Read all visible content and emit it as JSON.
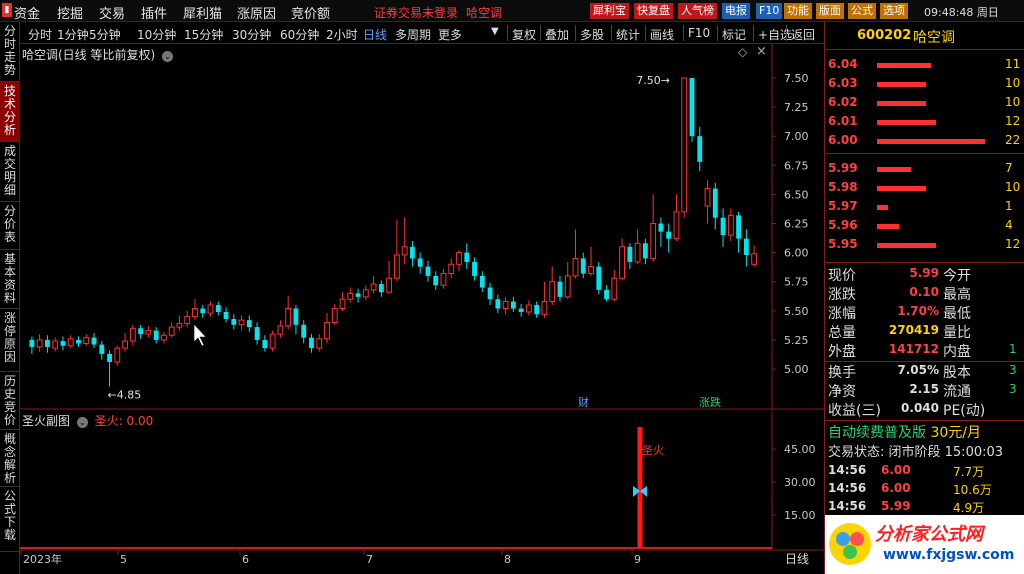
{
  "menu": {
    "items": [
      "资金",
      "挖掘",
      "交易",
      "插件",
      "犀利猫",
      "涨原因",
      "竞价额"
    ],
    "trade_status": "证券交易未登录",
    "stock_name": "哈空调",
    "chips": [
      {
        "label": "犀利宝",
        "color": "#c01818"
      },
      {
        "label": "快复盘",
        "color": "#c01818"
      },
      {
        "label": "人气榜",
        "color": "#c01818"
      },
      {
        "label": "电报",
        "color": "#1d5fb3"
      },
      {
        "label": "F10",
        "color": "#1d5fb3"
      },
      {
        "label": "功能",
        "color": "#c07000"
      },
      {
        "label": "版面",
        "color": "#c07000"
      },
      {
        "label": "公式",
        "color": "#c07000"
      },
      {
        "label": "选项",
        "color": "#c07000"
      }
    ],
    "clock": "09:48:48 周日"
  },
  "left_tabs": [
    {
      "label": "分时走势",
      "active": false
    },
    {
      "label": "技术分析",
      "active": true
    },
    {
      "label": "成交明细",
      "active": false
    },
    {
      "label": "分价表",
      "active": false
    },
    {
      "label": "基本资料",
      "active": false
    },
    {
      "label": "涨停原因",
      "active": false
    },
    {
      "label": "历史竞价",
      "active": false
    },
    {
      "label": "概念解析",
      "active": false
    },
    {
      "label": "公式下载",
      "active": false
    }
  ],
  "toolbar": {
    "periods": [
      "分时",
      "1分钟",
      "5分钟",
      "10分钟",
      "15分钟",
      "30分钟",
      "60分钟",
      "2小时",
      "日线",
      "多周期",
      "更多"
    ],
    "active_period": "日线",
    "actions": [
      "复权",
      "叠加",
      "多股",
      "统计",
      "画线",
      "F10",
      "标记",
      "+自选",
      "返回"
    ]
  },
  "chart": {
    "title": "哈空调(日线 等比前复权)",
    "sub_title": "圣火副图",
    "sub_value_label": "圣火: 0.00",
    "sub_marker_text": "圣火",
    "high_label": "7.50",
    "low_label": "4.85",
    "event_tags": [
      "财",
      "涨跌"
    ],
    "time_labels": [
      "2023年",
      "5",
      "6",
      "7",
      "8",
      "9"
    ],
    "period_label": "日线",
    "colors": {
      "up": "#ff3030",
      "down": "#00e5ee",
      "axis": "#8a1a1a",
      "grid": "#5a1010"
    }
  },
  "chart_data": {
    "type": "candlestick",
    "y_ticks": [
      5.0,
      5.25,
      5.5,
      5.75,
      6.0,
      6.25,
      6.5,
      6.75,
      7.0,
      7.25,
      7.5
    ],
    "ylim": [
      4.82,
      7.62
    ],
    "sub_y_ticks": [
      15.0,
      30.0,
      45.0
    ],
    "sub_ylim": [
      0,
      55
    ],
    "sub_signal": {
      "value": 55,
      "month": "9"
    },
    "candles": [
      [
        5.25,
        5.19,
        5.28,
        5.13
      ],
      [
        5.19,
        5.25,
        5.3,
        5.15
      ],
      [
        5.25,
        5.19,
        5.29,
        5.14
      ],
      [
        5.18,
        5.24,
        5.27,
        5.15
      ],
      [
        5.24,
        5.2,
        5.28,
        5.16
      ],
      [
        5.2,
        5.26,
        5.29,
        5.18
      ],
      [
        5.25,
        5.22,
        5.28,
        5.19
      ],
      [
        5.22,
        5.27,
        5.3,
        5.2
      ],
      [
        5.27,
        5.21,
        5.31,
        5.18
      ],
      [
        5.21,
        5.13,
        5.24,
        5.08
      ],
      [
        5.13,
        5.06,
        5.16,
        4.85
      ],
      [
        5.06,
        5.18,
        5.2,
        5.03
      ],
      [
        5.18,
        5.24,
        5.31,
        5.15
      ],
      [
        5.24,
        5.35,
        5.38,
        5.2
      ],
      [
        5.35,
        5.3,
        5.38,
        5.26
      ],
      [
        5.3,
        5.33,
        5.37,
        5.27
      ],
      [
        5.33,
        5.25,
        5.36,
        5.22
      ],
      [
        5.25,
        5.29,
        5.32,
        5.22
      ],
      [
        5.29,
        5.36,
        5.4,
        5.27
      ],
      [
        5.36,
        5.39,
        5.46,
        5.33
      ],
      [
        5.39,
        5.45,
        5.5,
        5.36
      ],
      [
        5.45,
        5.52,
        5.6,
        5.42
      ],
      [
        5.52,
        5.48,
        5.55,
        5.44
      ],
      [
        5.48,
        5.55,
        5.58,
        5.45
      ],
      [
        5.55,
        5.49,
        5.58,
        5.46
      ],
      [
        5.49,
        5.43,
        5.53,
        5.4
      ],
      [
        5.43,
        5.38,
        5.47,
        5.34
      ],
      [
        5.38,
        5.42,
        5.46,
        5.33
      ],
      [
        5.42,
        5.36,
        5.46,
        5.32
      ],
      [
        5.36,
        5.25,
        5.4,
        5.21
      ],
      [
        5.25,
        5.18,
        5.29,
        5.15
      ],
      [
        5.18,
        5.3,
        5.33,
        5.15
      ],
      [
        5.3,
        5.37,
        5.42,
        5.27
      ],
      [
        5.37,
        5.52,
        5.63,
        5.34
      ],
      [
        5.52,
        5.38,
        5.55,
        5.3
      ],
      [
        5.38,
        5.27,
        5.42,
        5.22
      ],
      [
        5.27,
        5.18,
        5.3,
        5.14
      ],
      [
        5.18,
        5.26,
        5.3,
        5.15
      ],
      [
        5.26,
        5.4,
        5.48,
        5.22
      ],
      [
        5.4,
        5.52,
        5.56,
        5.38
      ],
      [
        5.52,
        5.6,
        5.66,
        5.5
      ],
      [
        5.6,
        5.65,
        5.7,
        5.57
      ],
      [
        5.65,
        5.62,
        5.69,
        5.57
      ],
      [
        5.62,
        5.68,
        5.72,
        5.59
      ],
      [
        5.68,
        5.73,
        5.8,
        5.65
      ],
      [
        5.73,
        5.66,
        5.76,
        5.62
      ],
      [
        5.66,
        5.78,
        5.93,
        5.65
      ],
      [
        5.78,
        5.98,
        6.28,
        5.75
      ],
      [
        5.98,
        6.05,
        6.3,
        5.9
      ],
      [
        6.05,
        5.95,
        6.1,
        5.88
      ],
      [
        5.95,
        5.88,
        6.0,
        5.82
      ],
      [
        5.88,
        5.8,
        5.93,
        5.75
      ],
      [
        5.8,
        5.72,
        5.84,
        5.68
      ],
      [
        5.72,
        5.82,
        5.86,
        5.69
      ],
      [
        5.82,
        5.9,
        5.95,
        5.78
      ],
      [
        5.9,
        6.0,
        6.02,
        5.84
      ],
      [
        6.0,
        5.92,
        6.08,
        5.86
      ],
      [
        5.92,
        5.8,
        5.96,
        5.76
      ],
      [
        5.8,
        5.7,
        5.84,
        5.66
      ],
      [
        5.7,
        5.6,
        5.74,
        5.55
      ],
      [
        5.6,
        5.52,
        5.64,
        5.48
      ],
      [
        5.52,
        5.58,
        5.62,
        5.47
      ],
      [
        5.58,
        5.52,
        5.62,
        5.49
      ],
      [
        5.52,
        5.49,
        5.56,
        5.45
      ],
      [
        5.49,
        5.55,
        5.59,
        5.46
      ],
      [
        5.55,
        5.47,
        5.58,
        5.44
      ],
      [
        5.47,
        5.58,
        5.75,
        5.44
      ],
      [
        5.58,
        5.75,
        5.88,
        5.55
      ],
      [
        5.75,
        5.62,
        5.8,
        5.58
      ],
      [
        5.62,
        5.8,
        5.92,
        5.6
      ],
      [
        5.8,
        5.95,
        6.2,
        5.78
      ],
      [
        5.95,
        5.82,
        6.0,
        5.78
      ],
      [
        5.82,
        5.88,
        6.05,
        5.8
      ],
      [
        5.88,
        5.68,
        5.92,
        5.64
      ],
      [
        5.68,
        5.6,
        5.72,
        5.58
      ],
      [
        5.6,
        5.78,
        5.85,
        5.58
      ],
      [
        5.78,
        6.05,
        6.12,
        5.76
      ],
      [
        6.05,
        5.92,
        6.08,
        5.86
      ],
      [
        5.92,
        6.08,
        6.2,
        5.9
      ],
      [
        6.08,
        5.95,
        6.12,
        5.9
      ],
      [
        5.95,
        6.25,
        6.5,
        5.92
      ],
      [
        6.25,
        6.18,
        6.3,
        6.05
      ],
      [
        6.18,
        6.12,
        6.25,
        6.0
      ],
      [
        6.12,
        6.35,
        6.5,
        6.1
      ],
      [
        6.35,
        7.5,
        7.5,
        6.3
      ],
      [
        7.5,
        7.0,
        7.5,
        6.95
      ],
      [
        7.0,
        6.78,
        7.08,
        6.7
      ],
      [
        6.4,
        6.55,
        6.62,
        6.25
      ],
      [
        6.55,
        6.3,
        6.6,
        6.2
      ],
      [
        6.3,
        6.15,
        6.38,
        6.05
      ],
      [
        6.15,
        6.32,
        6.38,
        6.1
      ],
      [
        6.32,
        6.12,
        6.35,
        6.0
      ],
      [
        6.12,
        5.98,
        6.2,
        5.88
      ],
      [
        5.9,
        5.99,
        6.06,
        5.88
      ]
    ]
  },
  "right": {
    "code": "600202",
    "name": "哈空调",
    "order_book": [
      {
        "price": "6.04",
        "vol": "11",
        "bar": 0.3
      },
      {
        "price": "6.03",
        "vol": "10",
        "bar": 0.27
      },
      {
        "price": "6.02",
        "vol": "10",
        "bar": 0.27
      },
      {
        "price": "6.01",
        "vol": "12",
        "bar": 0.33
      },
      {
        "price": "6.00",
        "vol": "22",
        "bar": 0.6
      },
      {
        "price": "5.99",
        "vol": "7",
        "bar": 0.19
      },
      {
        "price": "5.98",
        "vol": "10",
        "bar": 0.27
      },
      {
        "price": "5.97",
        "vol": "1",
        "bar": 0.06
      },
      {
        "price": "5.96",
        "vol": "4",
        "bar": 0.12
      },
      {
        "price": "5.95",
        "vol": "12",
        "bar": 0.33
      }
    ],
    "quote": [
      {
        "l": "现价",
        "v": "5.99",
        "c": "r",
        "l2": "今开",
        "v2": ""
      },
      {
        "l": "涨跌",
        "v": "0.10",
        "c": "r",
        "l2": "最高",
        "v2": ""
      },
      {
        "l": "涨幅",
        "v": "1.70%",
        "c": "r",
        "l2": "最低",
        "v2": ""
      },
      {
        "l": "总量",
        "v": "270419",
        "c": "y",
        "l2": "量比",
        "v2": ""
      },
      {
        "l": "外盘",
        "v": "141712",
        "c": "r",
        "l2": "内盘",
        "v2": "1"
      }
    ],
    "quote2": [
      {
        "l": "换手",
        "v": "7.05%",
        "c": "w",
        "l2": "股本",
        "v2": "3"
      },
      {
        "l": "净资",
        "v": "2.15",
        "c": "w",
        "l2": "流通",
        "v2": "3"
      },
      {
        "l": "收益(三)",
        "v": "0.040",
        "c": "w",
        "l2": "PE(动)",
        "v2": ""
      }
    ],
    "fee_text": "自动续费普及版",
    "fee_price": "30元/月",
    "trade_state": "交易状态: 闭市阶段 15:00:03",
    "ticks": [
      {
        "t": "14:56",
        "p": "6.00",
        "v": "7.7万"
      },
      {
        "t": "14:56",
        "p": "6.00",
        "v": "10.6万"
      },
      {
        "t": "14:56",
        "p": "5.99",
        "v": "4.9万"
      }
    ],
    "watermark_title": "分析家公式网",
    "watermark_url": "www.fxjgsw.com"
  }
}
